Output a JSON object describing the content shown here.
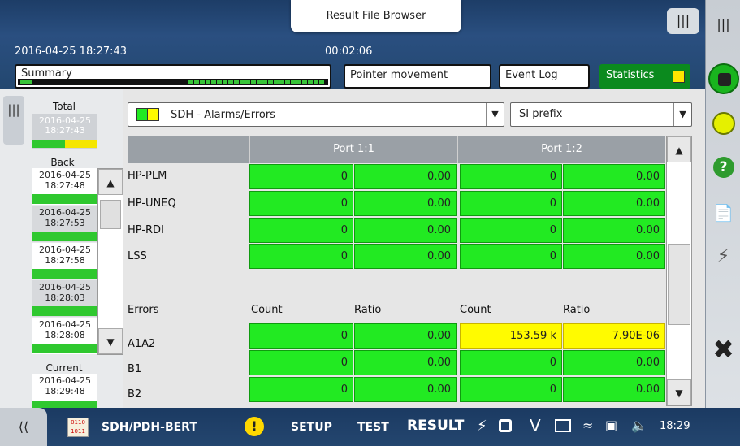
{
  "header": {
    "title": "Result File Browser",
    "datetime": "2016-04-25 18:27:43",
    "elapsed": "00:02:06",
    "tabs": {
      "summary": "Summary",
      "pointer": "Pointer movement",
      "eventlog": "Event Log",
      "statistics": "Statistics"
    }
  },
  "left_panel": {
    "total_label": "Total",
    "total_entry": "2016-04-25\n18:27:43",
    "back_label": "Back",
    "entries": [
      {
        "date": "2016-04-25",
        "time": "18:27:48"
      },
      {
        "date": "2016-04-25",
        "time": "18:27:53"
      },
      {
        "date": "2016-04-25",
        "time": "18:27:58"
      },
      {
        "date": "2016-04-25",
        "time": "18:28:03"
      },
      {
        "date": "2016-04-25",
        "time": "18:28:08"
      }
    ],
    "current_label": "Current",
    "current_date": "2016-04-25",
    "current_time": "18:29:48"
  },
  "filters": {
    "view": "SDH - Alarms/Errors",
    "prefix": "SI prefix"
  },
  "grid": {
    "port1": "Port 1:1",
    "port2": "Port 1:2",
    "alarm_rows": [
      {
        "label": "HP-PLM",
        "v": [
          "0",
          "0.00",
          "0",
          "0.00"
        ]
      },
      {
        "label": "HP-UNEQ",
        "v": [
          "0",
          "0.00",
          "0",
          "0.00"
        ]
      },
      {
        "label": "HP-RDI",
        "v": [
          "0",
          "0.00",
          "0",
          "0.00"
        ]
      },
      {
        "label": "LSS",
        "v": [
          "0",
          "0.00",
          "0",
          "0.00"
        ]
      }
    ],
    "errors_label": "Errors",
    "count_label": "Count",
    "ratio_label": "Ratio",
    "error_rows": [
      {
        "label": "A1A2",
        "v": [
          "0",
          "0.00",
          "153.59 k",
          "7.90E-06"
        ]
      },
      {
        "label": "B1",
        "v": [
          "0",
          "0.00",
          "0",
          "0.00"
        ]
      },
      {
        "label": "B2",
        "v": [
          "0",
          "0.00",
          "0",
          "0.00"
        ]
      }
    ]
  },
  "bottom": {
    "app": "SDH/PDH-BERT",
    "setup": "SETUP",
    "test": "TEST",
    "result": "RESULT",
    "time": "18:29"
  },
  "colors": {
    "green": "#22ea22",
    "yellow": "#fffb00",
    "statistics": "#0b8a1e"
  }
}
